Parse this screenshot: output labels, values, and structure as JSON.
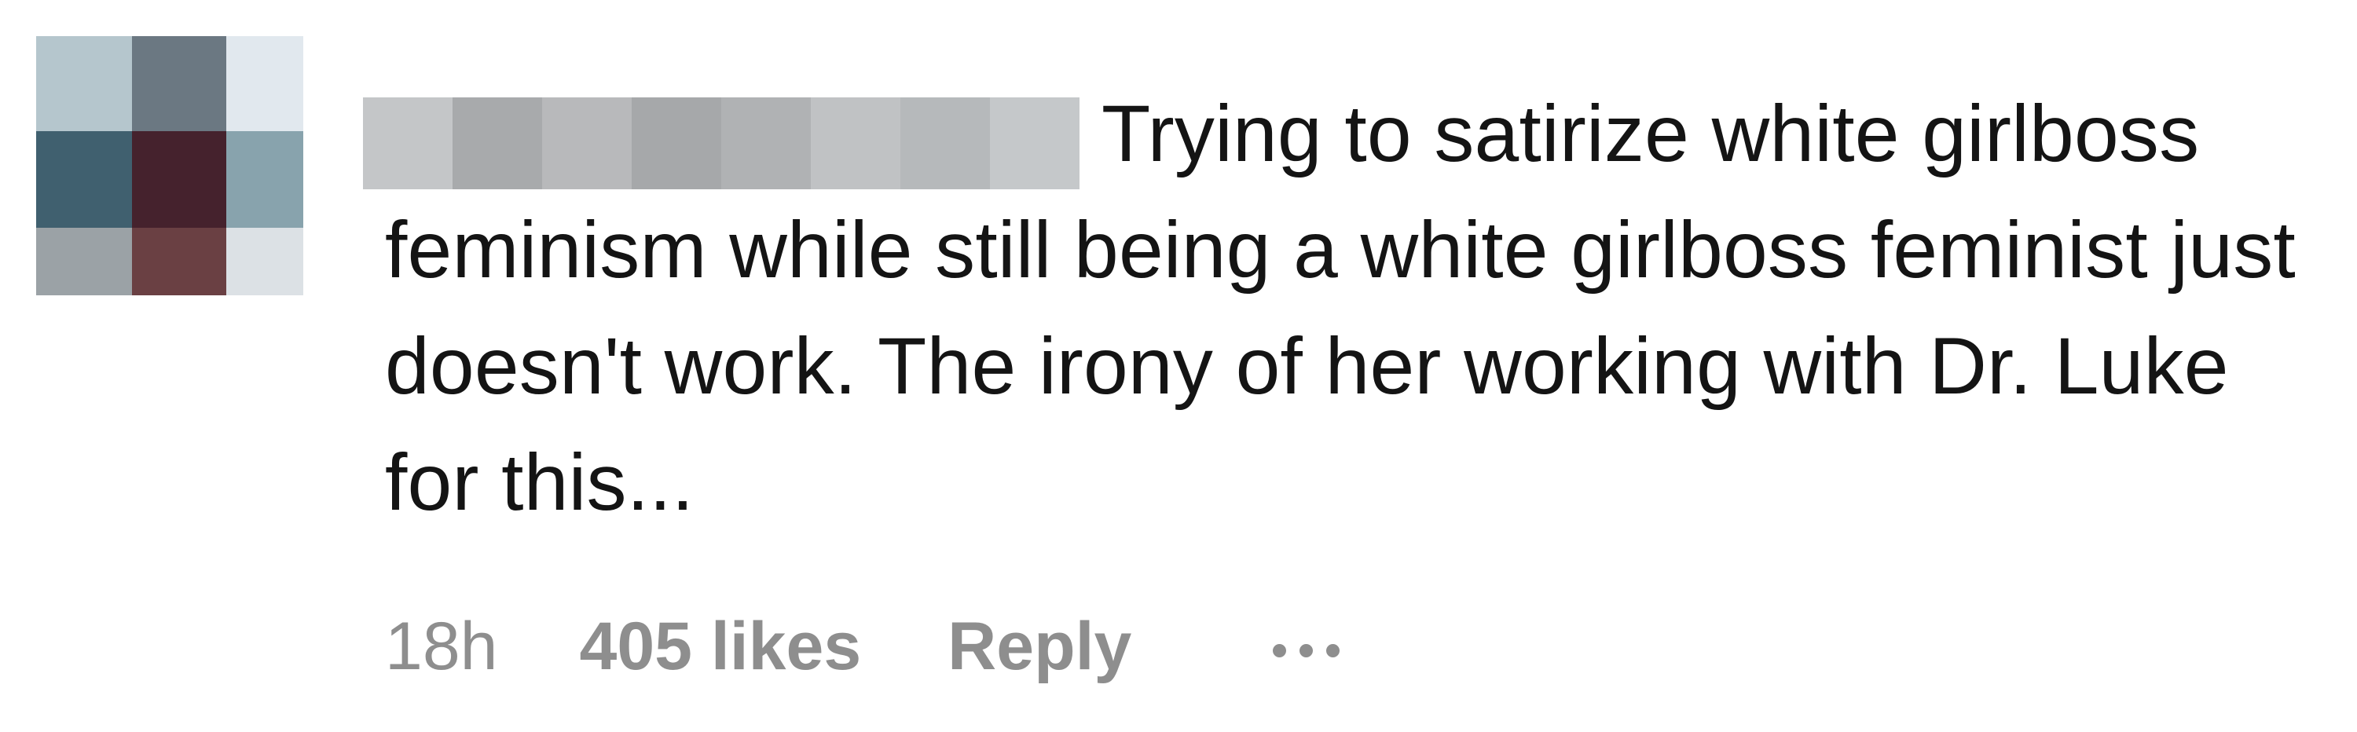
{
  "comment": {
    "avatar_icon": "pixelated-avatar",
    "avatar_mosaic": [
      "#b5c6cd",
      "#6b7882",
      "#e1e8ee",
      "#40606f",
      "#45222d",
      "#88a3ad",
      "#9ba2a6",
      "#6a4043",
      "#dce1e5"
    ],
    "username_mosaic": [
      "#c4c6c8",
      "#a8aaac",
      "#b8b9bb",
      "#a6a8aa",
      "#b0b2b4",
      "#c0c2c4",
      "#b6b9bb",
      "#c5c8ca"
    ],
    "text": "Trying to satirize white girlboss feminism while still being a white girlboss feminist just doesn't work. The irony of her working with Dr. Luke for this...",
    "timestamp": "18h",
    "likes": "405 likes",
    "reply_label": "Reply",
    "more_icon": "ellipsis-icon"
  }
}
